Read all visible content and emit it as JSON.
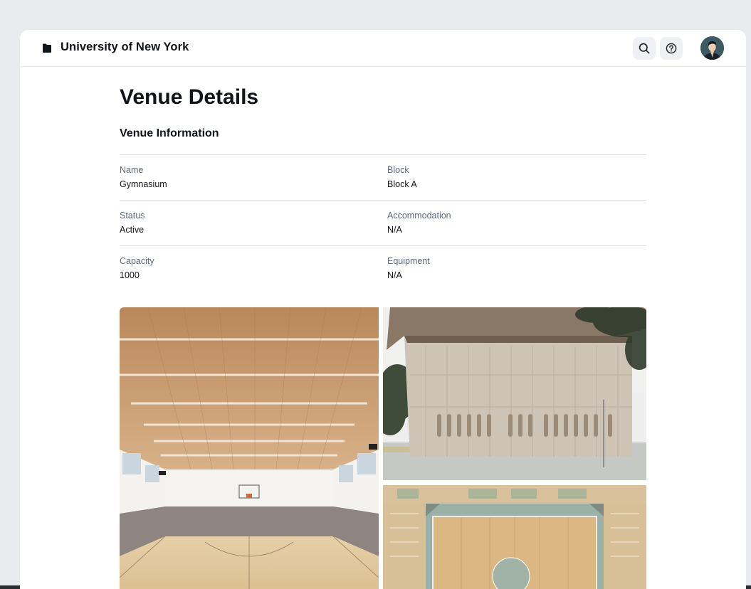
{
  "header": {
    "org_name": "University of New York",
    "brand_icon": "folder-icon",
    "search_icon": "search-icon",
    "help_icon": "help-icon",
    "avatar_icon": "user-avatar"
  },
  "page": {
    "title": "Venue Details",
    "section_title": "Venue Information"
  },
  "venue": {
    "rows": [
      {
        "left": {
          "label": "Name",
          "value": "Gymnasium"
        },
        "right": {
          "label": "Block",
          "value": "Block A"
        }
      },
      {
        "left": {
          "label": "Status",
          "value": "Active"
        },
        "right": {
          "label": "Accommodation",
          "value": "N/A"
        }
      },
      {
        "left": {
          "label": "Capacity",
          "value": "1000"
        },
        "right": {
          "label": "Equipment",
          "value": "N/A"
        }
      }
    ]
  },
  "gallery": {
    "photos": [
      {
        "name": "gym-interior-photo"
      },
      {
        "name": "gym-exterior-photo"
      },
      {
        "name": "gym-floor-plan-photo"
      }
    ]
  },
  "colors": {
    "background": "#e9ebef",
    "panel": "#ffffff",
    "text": "#111418",
    "muted": "#5f6b7a",
    "divider": "#e1e4e8"
  }
}
